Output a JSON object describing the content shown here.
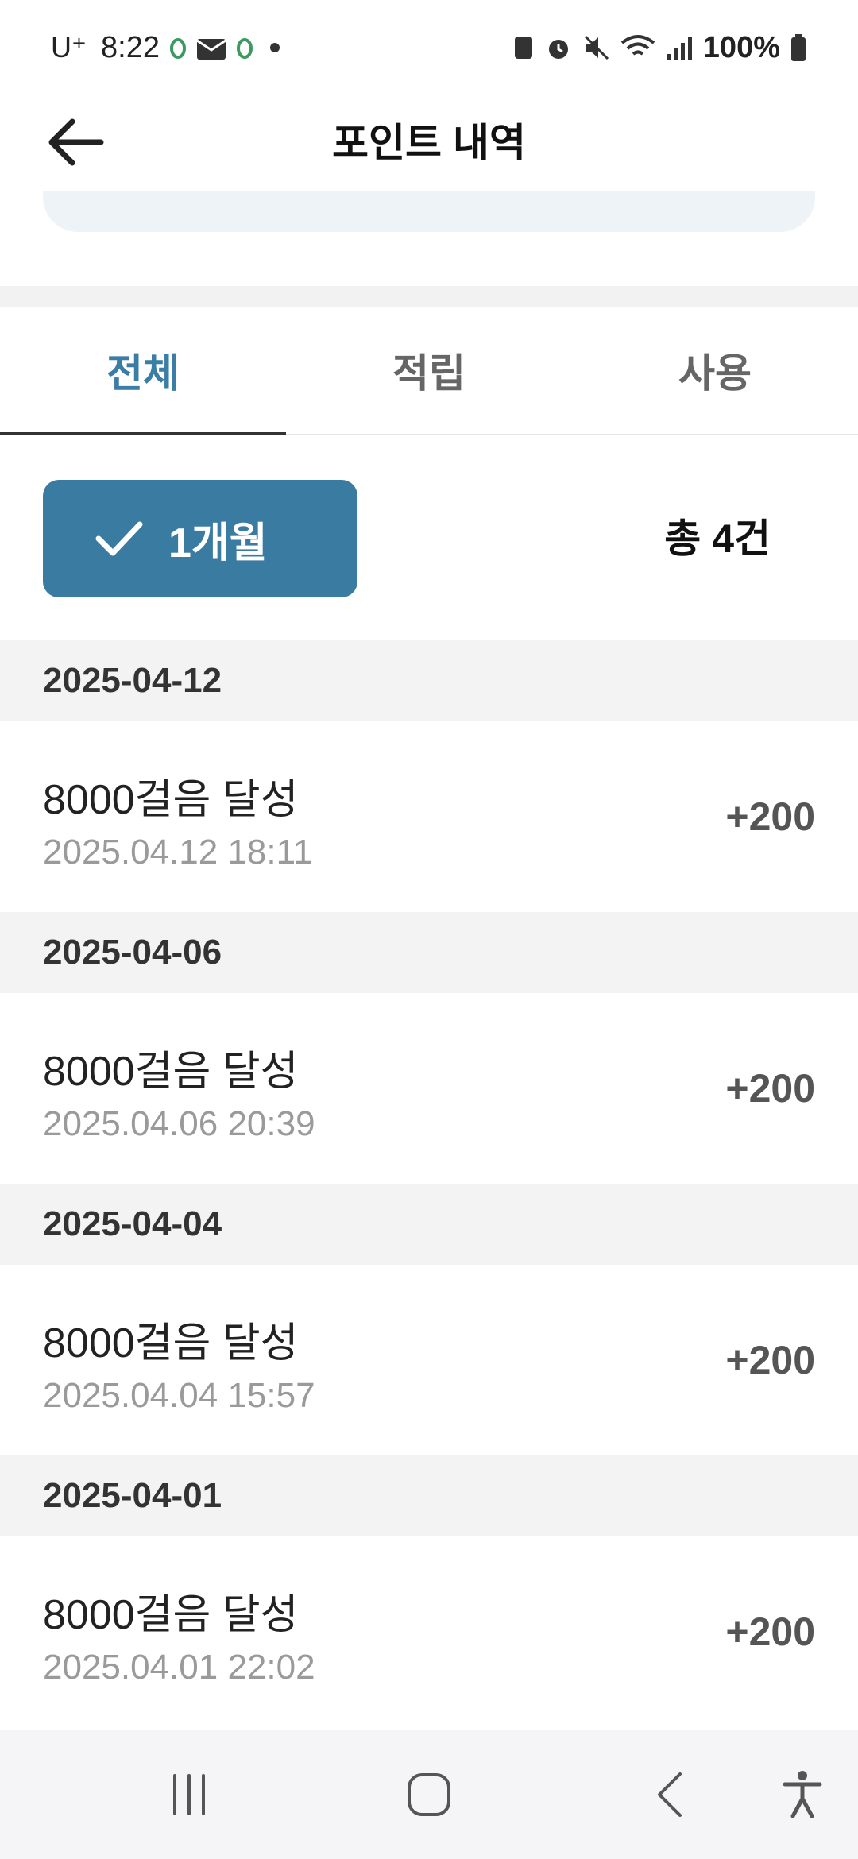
{
  "status_bar": {
    "carrier": "U⁺",
    "time": "8:22",
    "battery": "100%"
  },
  "header": {
    "title": "포인트 내역"
  },
  "tabs": [
    {
      "label": "전체",
      "active": true
    },
    {
      "label": "적립",
      "active": false
    },
    {
      "label": "사용",
      "active": false
    }
  ],
  "filter": {
    "period_label": "1개월",
    "total_label": "총 4건"
  },
  "groups": [
    {
      "date": "2025-04-12",
      "items": [
        {
          "title": "8000걸음 달성",
          "datetime": "2025.04.12 18:11",
          "points": "+200"
        }
      ]
    },
    {
      "date": "2025-04-06",
      "items": [
        {
          "title": "8000걸음 달성",
          "datetime": "2025.04.06 20:39",
          "points": "+200"
        }
      ]
    },
    {
      "date": "2025-04-04",
      "items": [
        {
          "title": "8000걸음 달성",
          "datetime": "2025.04.04 15:57",
          "points": "+200"
        }
      ]
    },
    {
      "date": "2025-04-01",
      "items": [
        {
          "title": "8000걸음 달성",
          "datetime": "2025.04.01 22:02",
          "points": "+200"
        }
      ]
    }
  ],
  "colors": {
    "accent": "#3a7ba1",
    "tab_active": "#3a7da5",
    "section_bg": "#f3f3f3"
  },
  "icons": {
    "back": "arrow-left-icon",
    "check": "check-icon",
    "nav_recents": "recents-icon",
    "nav_home": "home-icon",
    "nav_back": "back-icon",
    "nav_accessibility": "accessibility-icon"
  }
}
